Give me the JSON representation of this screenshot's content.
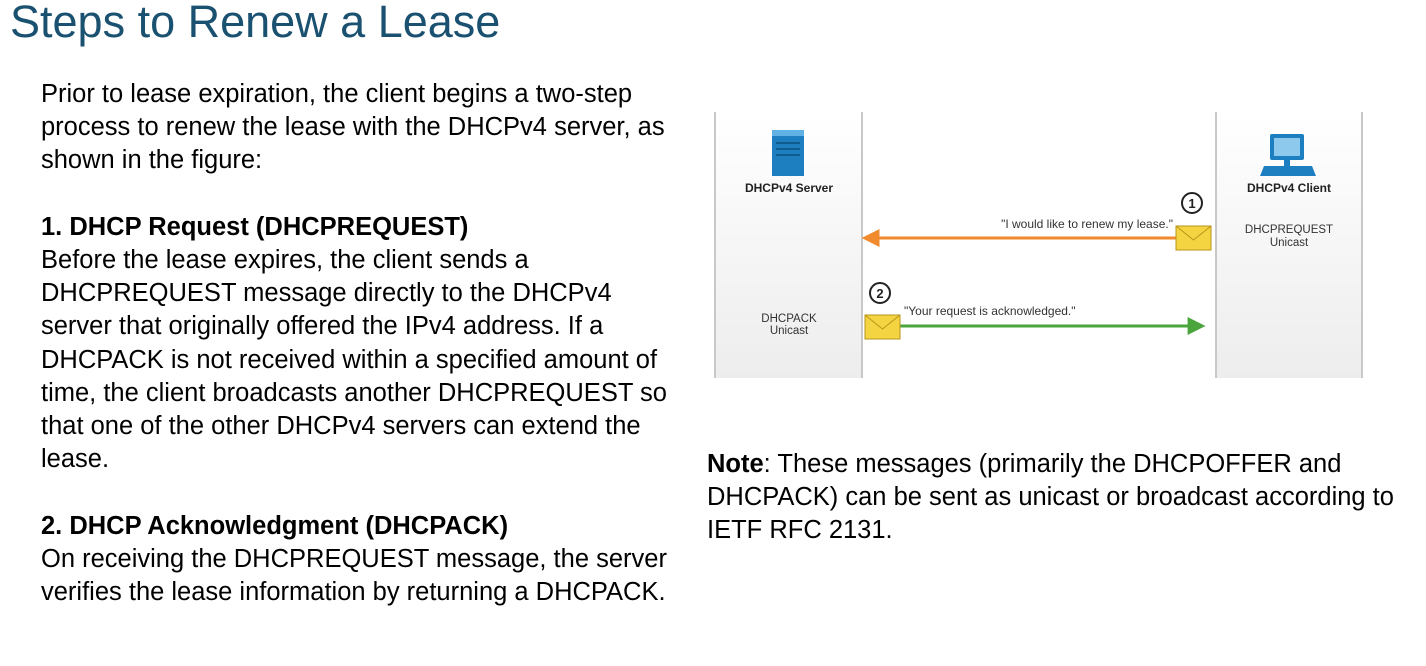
{
  "slide": {
    "title": "Steps to Renew a Lease",
    "intro": "Prior to lease expiration, the client begins a two-step process to renew the lease with the DHCPv4 server, as shown in the figure:",
    "steps": [
      {
        "heading": "1. DHCP Request (DHCPREQUEST)",
        "body": "Before the lease expires, the client sends a DHCPREQUEST message directly to the DHCPv4 server that originally offered the IPv4 address. If a DHCPACK is not received within a specified amount of time, the client broadcasts another DHCPREQUEST so that one of the other DHCPv4 servers can extend the lease."
      },
      {
        "heading": "2. DHCP Acknowledgment (DHCPACK)",
        "body": "On receiving the DHCPREQUEST message, the server verifies the lease information by returning a DHCPACK."
      }
    ],
    "note": {
      "label": "Note",
      "text": ": These messages (primarily the DHCPOFFER and DHCPACK) can be sent as unicast or broadcast according to IETF RFC 2131."
    }
  },
  "figure": {
    "server_label": "DHCPv4 Server",
    "client_label": "DHCPv4 Client",
    "server_msg_line1": "DHCPACK",
    "server_msg_line2": "Unicast",
    "client_msg_line1": "DHCPREQUEST",
    "client_msg_line2": "Unicast",
    "step1_number": "1",
    "step2_number": "2",
    "step1_quote": "\"I would like to renew my lease.\"",
    "step2_quote": "\"Your request is acknowledged.\"",
    "colors": {
      "request_arrow": "#f08a2c",
      "ack_arrow": "#4aa63c",
      "server_icon": "#1d7fbf",
      "client_icon": "#1d7fbf",
      "envelope": "#f5d442"
    },
    "icons": {
      "server": "server-icon",
      "client": "computer-icon",
      "envelope": "envelope-icon"
    }
  }
}
